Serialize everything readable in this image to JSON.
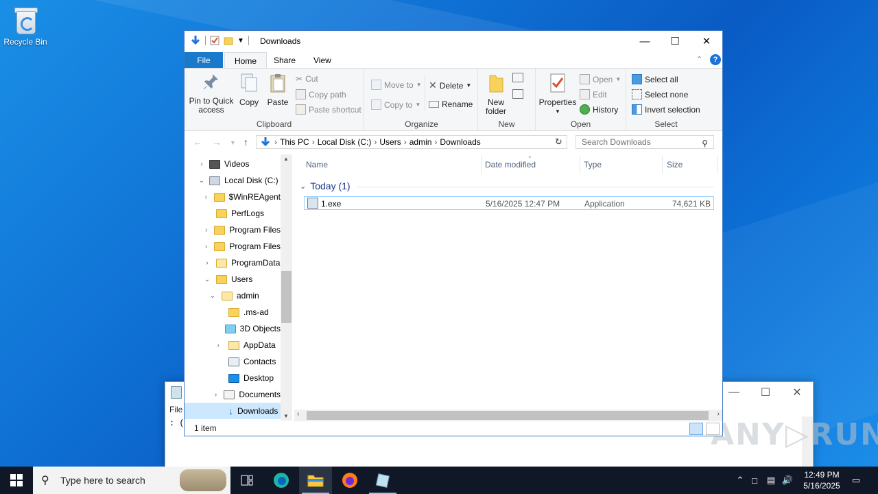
{
  "desktop": {
    "recycle_bin_label": "Recycle Bin"
  },
  "watermark": "ANY▷RUN",
  "notepad": {
    "menu_file": "File",
    "text": ": ("
  },
  "explorer": {
    "title": "Downloads",
    "tabs": {
      "file": "File",
      "home": "Home",
      "share": "Share",
      "view": "View"
    },
    "ribbon": {
      "clipboard": {
        "label": "Clipboard",
        "pin": "Pin to Quick access",
        "copy": "Copy",
        "paste": "Paste",
        "cut": "Cut",
        "copy_path": "Copy path",
        "paste_shortcut": "Paste shortcut"
      },
      "organize": {
        "label": "Organize",
        "move_to": "Move to",
        "copy_to": "Copy to",
        "delete": "Delete",
        "rename": "Rename"
      },
      "new": {
        "label": "New",
        "new_folder": "New folder"
      },
      "open": {
        "label": "Open",
        "properties": "Properties",
        "open": "Open",
        "edit": "Edit",
        "history": "History"
      },
      "select": {
        "label": "Select",
        "select_all": "Select all",
        "select_none": "Select none",
        "invert": "Invert selection"
      }
    },
    "address": {
      "crumbs": [
        "This PC",
        "Local Disk (C:)",
        "Users",
        "admin",
        "Downloads"
      ],
      "search_placeholder": "Search Downloads"
    },
    "nav_items": [
      {
        "label": "Videos"
      },
      {
        "label": "Local Disk (C:)"
      },
      {
        "label": "$WinREAgent"
      },
      {
        "label": "PerfLogs"
      },
      {
        "label": "Program Files"
      },
      {
        "label": "Program Files"
      },
      {
        "label": "ProgramData"
      },
      {
        "label": "Users"
      },
      {
        "label": "admin"
      },
      {
        "label": ".ms-ad"
      },
      {
        "label": "3D Objects"
      },
      {
        "label": "AppData"
      },
      {
        "label": "Contacts"
      },
      {
        "label": "Desktop"
      },
      {
        "label": "Documents"
      },
      {
        "label": "Downloads"
      }
    ],
    "columns": {
      "name": "Name",
      "date": "Date modified",
      "type": "Type",
      "size": "Size"
    },
    "group_header": "Today (1)",
    "files": [
      {
        "name": "1.exe",
        "date": "5/16/2025 12:47 PM",
        "type": "Application",
        "size": "74,621 KB"
      }
    ],
    "status": "1 item"
  },
  "taskbar": {
    "search_placeholder": "Type here to search",
    "time": "12:49 PM",
    "date": "5/16/2025"
  }
}
